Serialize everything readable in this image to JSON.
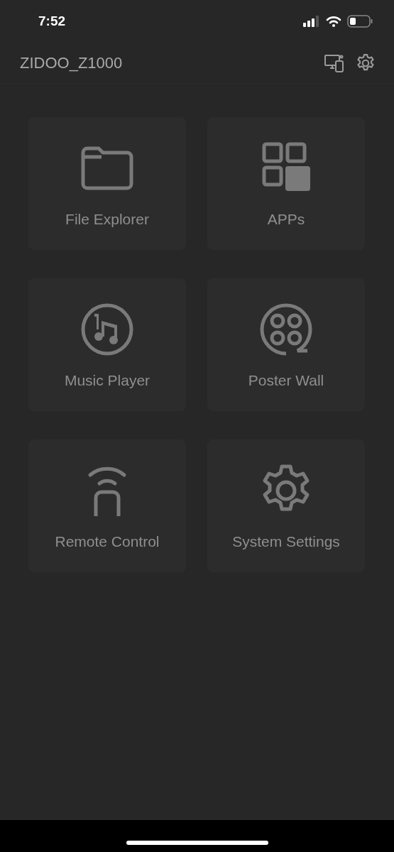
{
  "status_bar": {
    "time": "7:52"
  },
  "header": {
    "title": "ZIDOO_Z1000"
  },
  "tiles": [
    {
      "kind": "files",
      "label": "File Explorer"
    },
    {
      "kind": "apps",
      "label": "APPs"
    },
    {
      "kind": "music",
      "label": "Music Player"
    },
    {
      "kind": "poster",
      "label": "Poster Wall"
    },
    {
      "kind": "remote",
      "label": "Remote Control"
    },
    {
      "kind": "settings",
      "label": "System Settings"
    }
  ]
}
